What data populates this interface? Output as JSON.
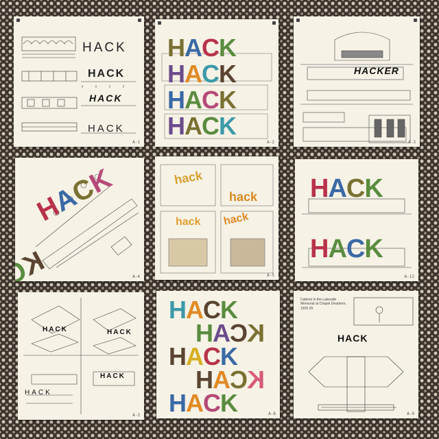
{
  "photo": {
    "posters": [
      {
        "id": "p1",
        "title": "HACK",
        "labels": [
          "HACK",
          "HACK",
          "HACK",
          "HACK"
        ],
        "sheet": "A-1"
      },
      {
        "id": "p2",
        "title": "HACK",
        "rows": [
          "HACK",
          "HACK",
          "HACK",
          "HACK"
        ],
        "sheet": "A-2"
      },
      {
        "id": "p3",
        "title": "HACKER",
        "sheet": "A-3"
      },
      {
        "id": "p4",
        "title": "HACK",
        "mirror": "HACK",
        "sheet": "A-4"
      },
      {
        "id": "p5",
        "labels": [
          "hack",
          "hack",
          "hack",
          "hack"
        ],
        "sheet": "A-5"
      },
      {
        "id": "p6",
        "rows": [
          "HACK",
          "HACK"
        ],
        "sheet": "A-12"
      },
      {
        "id": "p7",
        "labels": [
          "HACK",
          "HACK",
          "HACK",
          "HACK"
        ],
        "sheet": "A-3"
      },
      {
        "id": "p8",
        "rows": [
          "HACK",
          "HACK",
          "HACK",
          "HACK",
          "HACK"
        ],
        "sheet": "A-8"
      },
      {
        "id": "p9",
        "title": "HACK",
        "caption": "Cabinet in the Lakeside Memorial at Chapel Dearborn, 1926-35",
        "sheet": "A-9"
      }
    ],
    "palette": {
      "olive": "#7a7032",
      "blue": "#3a69a5",
      "red": "#b8324a",
      "green": "#5a8c3f",
      "purple": "#6c4c8c",
      "orange": "#e08a25",
      "teal": "#3c9aa8",
      "brown": "#5a4431",
      "yellow": "#d6b021",
      "magenta": "#b54a78",
      "pink": "#d85a7a",
      "gray": "#76706a"
    }
  }
}
